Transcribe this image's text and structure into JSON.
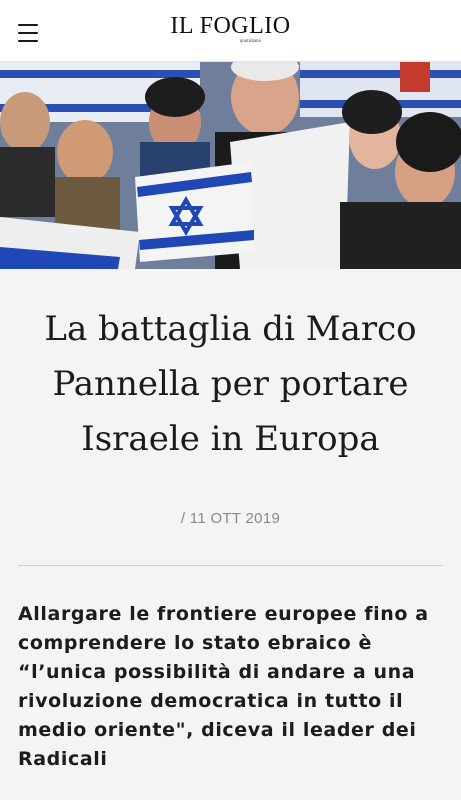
{
  "header": {
    "logo_text": "IL FOGLIO",
    "logo_subtitle": "quotidiano",
    "menu_icon": "hamburger-menu-icon"
  },
  "hero": {
    "image_desc_icon": "news-photo",
    "colors": {
      "flag_white": "#f2f2f2",
      "flag_blue": "#1f47b5"
    }
  },
  "article": {
    "headline": "La battaglia di Marco Pannella per portare Israele in Europa",
    "date": "/ 11 OTT 2019",
    "summary": "Allargare le frontiere europee fino a comprendere lo stato ebraico è “l’unica possibilità di andare a una rivoluzione democratica in tutto il medio oriente\", diceva il leader dei Radicali"
  },
  "colors": {
    "background": "#f4f4f4",
    "header_bg": "#ffffff",
    "text": "#1a1a1a",
    "date_text": "#8a8a8a",
    "divider": "#cfcfcf"
  }
}
